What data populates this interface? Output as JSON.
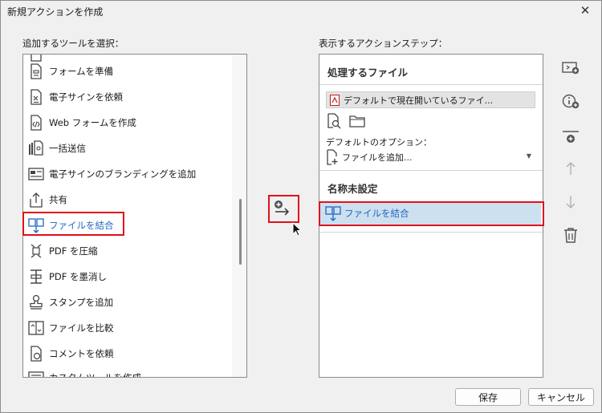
{
  "window": {
    "title": "新規アクションを作成",
    "close_glyph": "✕"
  },
  "left_label": "追加するツールを選択：",
  "right_label": "表示するアクションステップ：",
  "tools": [
    {
      "label": "フォームを準備",
      "icon": "form-icon"
    },
    {
      "label": "電子サインを依頼",
      "icon": "request-signature-icon"
    },
    {
      "label": "Web フォームを作成",
      "icon": "web-form-icon"
    },
    {
      "label": "一括送信",
      "icon": "bulk-send-icon"
    },
    {
      "label": "電子サインのブランディングを追加",
      "icon": "branding-icon"
    },
    {
      "label": "共有",
      "icon": "share-icon"
    },
    {
      "label": "ファイルを結合",
      "icon": "combine-files-icon",
      "selected": true
    },
    {
      "label": "PDF を圧縮",
      "icon": "compress-pdf-icon"
    },
    {
      "label": "PDF を墨消し",
      "icon": "redact-pdf-icon"
    },
    {
      "label": "スタンプを追加",
      "icon": "stamp-icon"
    },
    {
      "label": "ファイルを比較",
      "icon": "compare-files-icon"
    },
    {
      "label": "コメントを依頼",
      "icon": "request-comments-icon"
    },
    {
      "label": "カスタムツールを作成",
      "icon": "custom-tool-icon"
    }
  ],
  "steps": {
    "files_header": "処理するファイル",
    "default_file": "デフォルトで現在開いているファイ...",
    "options_label": "デフォルトのオプション：",
    "add_files": "ファイルを追加...",
    "unnamed_header": "名称未設定",
    "step_item": "ファイルを結合"
  },
  "buttons": {
    "save": "保存",
    "cancel": "キャンセル"
  },
  "colors": {
    "highlight": "#e0101a",
    "accent": "#1f66c1",
    "selected_bg": "#cce0f0"
  }
}
